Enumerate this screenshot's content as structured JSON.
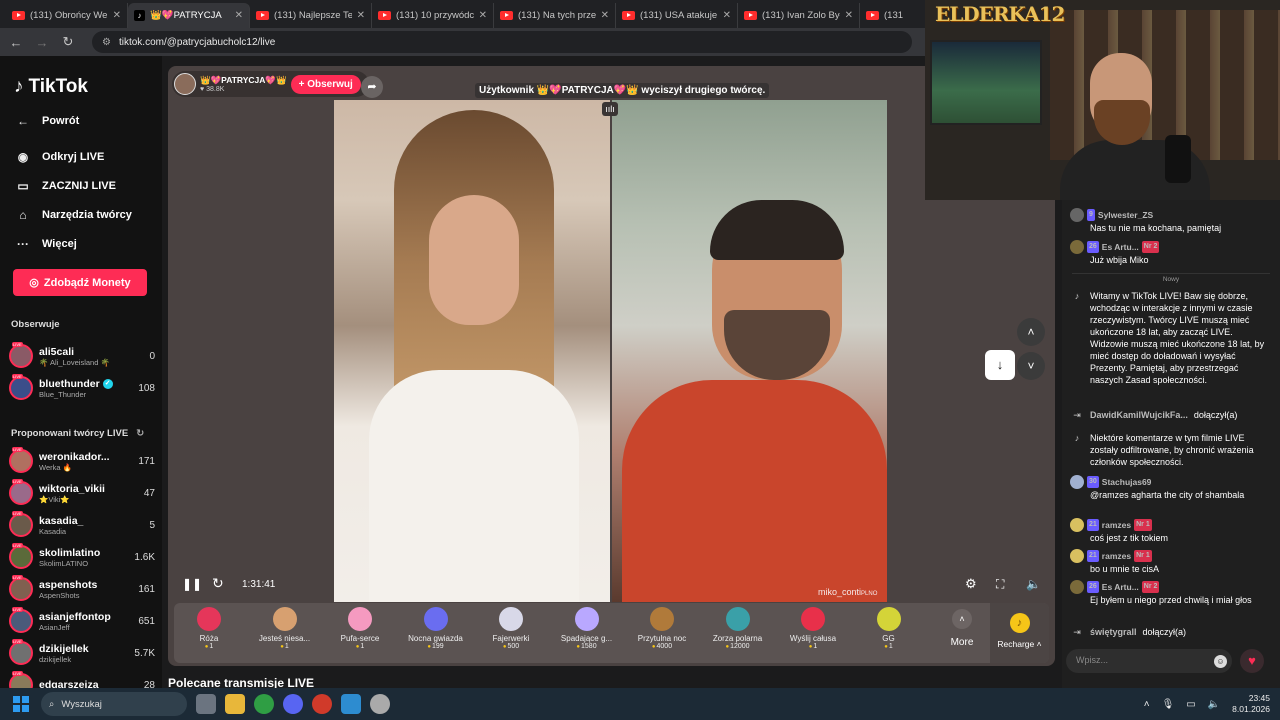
{
  "browser": {
    "tabs": [
      {
        "label": "(131) Obrońcy Wene",
        "icon": "youtube"
      },
      {
        "label": "👑💖PATRYCJA",
        "icon": "tiktok",
        "active": true
      },
      {
        "label": "(131) Najlepsze Tekst",
        "icon": "youtube"
      },
      {
        "label": "(131) 10 przywódców",
        "icon": "youtube"
      },
      {
        "label": "(131) Na tych przedm",
        "icon": "youtube"
      },
      {
        "label": "(131) USA atakuje We",
        "icon": "youtube"
      },
      {
        "label": "(131) Ivan Zolo Był K",
        "icon": "youtube"
      },
      {
        "label": "(131",
        "icon": "youtube"
      }
    ],
    "url": "tiktok.com/@patrycjabucholc12/live"
  },
  "sidebar": {
    "logo": "TikTok",
    "back": "Powrót",
    "nav": [
      "Odkryj LIVE",
      "ZACZNIJ LIVE",
      "Narzędzia twórcy",
      "Więcej"
    ],
    "coins_button": "Zdobądź Monety",
    "following_header": "Obserwuje",
    "following": [
      {
        "name": "ali5cali",
        "sub": "🌴 Ali_Loveisland 🌴",
        "count": "0"
      },
      {
        "name": "bluethunder",
        "sub": "Blue_Thunder",
        "count": "108"
      }
    ],
    "suggested_header": "Proponowani twórcy LIVE",
    "suggested": [
      {
        "name": "weronikador...",
        "sub": "Werka 🔥",
        "count": "171"
      },
      {
        "name": "wiktoria_vikii",
        "sub": "⭐Viki⭐",
        "count": "47"
      },
      {
        "name": "kasadia_",
        "sub": "Kasadia",
        "count": "5"
      },
      {
        "name": "skolimlatino",
        "sub": "SkolimLATINO",
        "count": "1.6K"
      },
      {
        "name": "aspenshots",
        "sub": "AspenShots",
        "count": "161"
      },
      {
        "name": "asianjeffontop",
        "sub": "AsianJeff",
        "count": "651"
      },
      {
        "name": "dzikijellek",
        "sub": "dzikijellek",
        "count": "5.7K"
      },
      {
        "name": "edgarszeiza",
        "sub": "",
        "count": "28"
      }
    ]
  },
  "stream": {
    "host_name": "👑💖PATRYCJA💖👑",
    "host_likes": "38.8K",
    "follow": "+ Obserwuj",
    "notice": "Użytkownik 👑💖PATRYCJA💖👑 wyciszył drugiego twórcę.",
    "time": "1:31:41",
    "guest_tag": "miko_conti",
    "guest_tag_suffix": "PLNO"
  },
  "gifts": [
    {
      "name": "Róża",
      "price": "1",
      "color": "#e5365a"
    },
    {
      "name": "Jesteś niesa...",
      "price": "1",
      "color": "#d7a070"
    },
    {
      "name": "Pufa-serce",
      "price": "1",
      "color": "#f59ac0"
    },
    {
      "name": "Nocna gwiazda",
      "price": "199",
      "color": "#6a6df0"
    },
    {
      "name": "Fajerwerki",
      "price": "500",
      "color": "#d8d8e8"
    },
    {
      "name": "Spadające g...",
      "price": "1580",
      "color": "#b9a8ff"
    },
    {
      "name": "Przytulna noc",
      "price": "4000",
      "color": "#b07a3a"
    },
    {
      "name": "Zorza polarna",
      "price": "12000",
      "color": "#3aa0a8"
    },
    {
      "name": "Wyślij całusa",
      "price": "1",
      "color": "#e8304a"
    },
    {
      "name": "GG",
      "price": "1",
      "color": "#d4d438"
    }
  ],
  "gift_more": "More",
  "recharge": "Recharge",
  "webcam_title": "ELDERKA12",
  "chat": [
    {
      "type": "user",
      "level": "9",
      "name": "Sylwester_ZS",
      "text": "Nas tu nie ma kochana, pamiętaj"
    },
    {
      "type": "user",
      "level": "26",
      "name": "Es Artu...",
      "rank": "Nr 2",
      "text": "Już wbija Miko"
    },
    {
      "type": "divider",
      "text": "Nowy"
    },
    {
      "type": "system",
      "text": "Witamy w TikTok LIVE! Baw się dobrze, wchodząc w interakcje z innymi w czasie rzeczywistym. Twórcy LIVE muszą mieć ukończone 18 lat, aby zacząć LIVE. Widzowie muszą mieć ukończone 18 lat, by mieć dostęp do doładowań i wysyłać Prezenty. Pamiętaj, aby przestrzegać naszych Zasad społeczności."
    },
    {
      "type": "join",
      "name": "DawidKamilWujcikFa...",
      "action": "dołączył(a)"
    },
    {
      "type": "system",
      "text": "Niektóre komentarze w tym filmie LIVE zostały odfiltrowane, by chronić wrażenia członków społeczności."
    },
    {
      "type": "user",
      "level": "30",
      "name": "Stachujas69",
      "text": "@ramzes agharta the city of shambala"
    },
    {
      "type": "user",
      "level": "21",
      "name": "ramzes",
      "rank": "Nr 1",
      "text": "coś jest z tik tokiem"
    },
    {
      "type": "user",
      "level": "21",
      "name": "ramzes",
      "rank": "Nr 1",
      "text": "bo u mnie te cisA"
    },
    {
      "type": "user",
      "level": "26",
      "name": "Es Artu...",
      "rank": "Nr 2",
      "text": "Ej byłem u niego przed chwilą i miał głos"
    },
    {
      "type": "join",
      "name": "świętygrall",
      "action": "dołączył(a)"
    }
  ],
  "chat_input_placeholder": "Wpisz...",
  "below_title": "Polecane transmisje LIVE",
  "taskbar": {
    "search": "Wyszukaj",
    "time": "23:45",
    "date": "8.01.2026"
  }
}
